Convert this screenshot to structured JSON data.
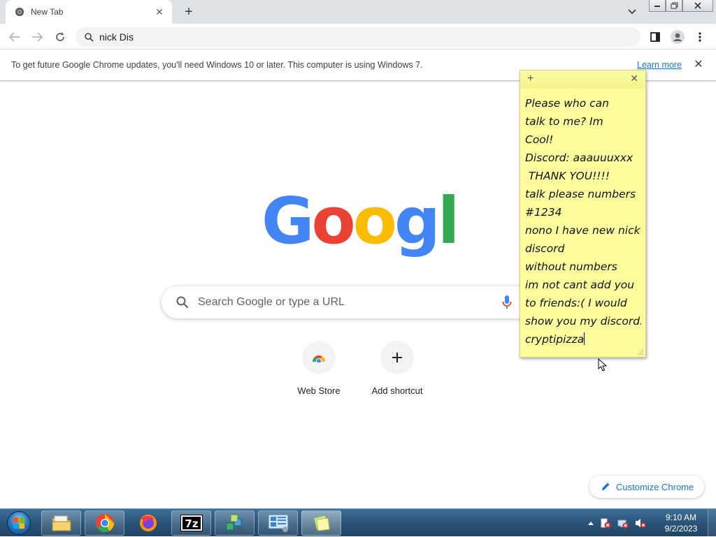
{
  "browser": {
    "tab_title": "New Tab",
    "omnibox_value": "nick Dis"
  },
  "infobar": {
    "message": "To get future Google Chrome updates, you'll need Windows 10 or later. This computer is using Windows 7.",
    "link_label": "Learn more"
  },
  "ntp": {
    "search_placeholder": "Search Google or type a URL",
    "shortcuts": [
      {
        "label": "Web Store",
        "icon": "web-store-icon"
      },
      {
        "label": "Add shortcut",
        "icon": "plus-icon"
      }
    ],
    "customize_label": "Customize Chrome"
  },
  "sticky_note": {
    "lines": [
      "Please who can",
      "talk to me? Im",
      "Cool!",
      "Discord: aaauuuxxx",
      " THANK YOU!!!!",
      "talk please numbers",
      "#1234",
      "nono I have new nick",
      "discord",
      "without numbers",
      "im not cant add you",
      "to friends:( I would",
      "show you my discord:",
      "cryptipizza"
    ]
  },
  "taskbar": {
    "apps": [
      "explorer-icon",
      "chrome-icon",
      "firefox-icon",
      "7zip-icon",
      "network-icon",
      "control-panel-icon",
      "sticky-notes-icon"
    ],
    "clock_time": "9:10 AM",
    "clock_date": "9/2/2023"
  },
  "colors": {
    "google_blue": "#4285f4",
    "google_red": "#ea4335",
    "google_yellow": "#fbbc05",
    "google_green": "#34a853",
    "sticky_yellow": "#fdfd9e",
    "link_blue": "#1a73e8"
  }
}
